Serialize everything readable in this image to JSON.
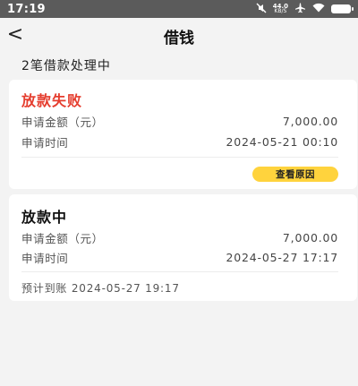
{
  "status_bar": {
    "time": "17:19",
    "speed_value": "44.0",
    "speed_unit": "KB/S",
    "icons": [
      "mute-icon",
      "airplane-icon",
      "wifi-icon",
      "battery-icon"
    ]
  },
  "header": {
    "back_glyph": "<",
    "title": "借钱"
  },
  "summary": "2笔借款处理中",
  "loans": [
    {
      "status": "放款失败",
      "status_color": "#e53d2e",
      "amount_label": "申请金额（元）",
      "amount": "7,000.00",
      "time_label": "申请时间",
      "time": "2024-05-21 00:10",
      "action_label": "查看原因"
    },
    {
      "status": "放款中",
      "amount_label": "申请金额（元）",
      "amount": "7,000.00",
      "time_label": "申请时间",
      "time": "2024-05-27 17:17",
      "eta_label": "预计到账",
      "eta": "2024-05-27 19:17"
    }
  ],
  "colors": {
    "accent_yellow": "#ffd33d",
    "failure_red": "#e53d2e"
  }
}
